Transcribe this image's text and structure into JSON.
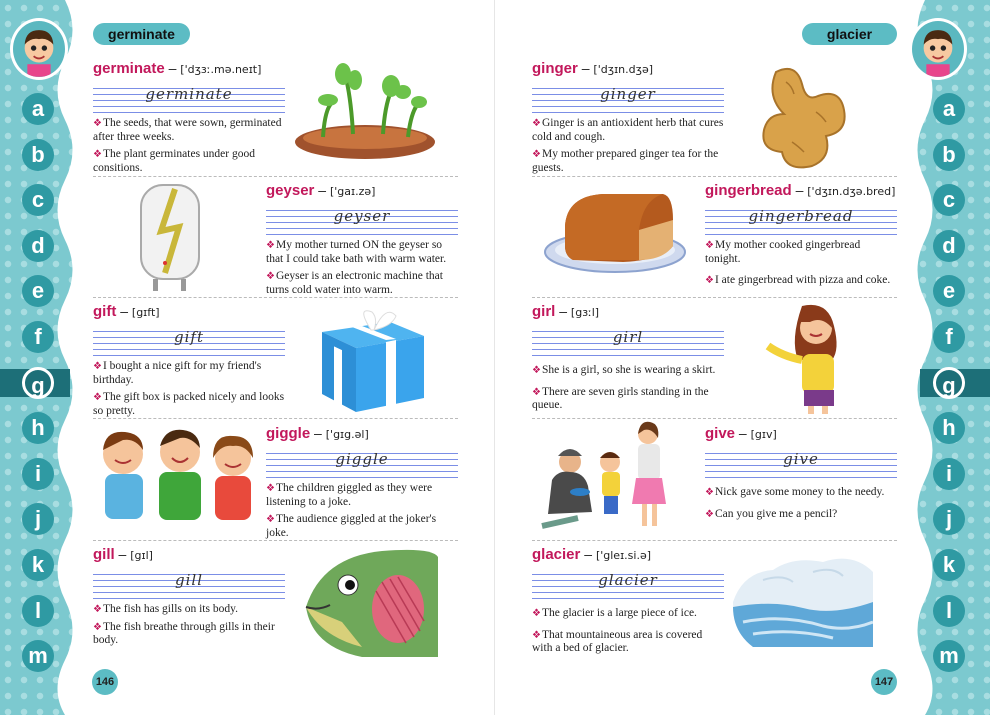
{
  "left_page": {
    "tab": "germinate",
    "page_number": "146",
    "entries": [
      {
        "word": "germinate",
        "pron": "['dʒɜː.mə.neɪt]",
        "cursive": "germinate",
        "sentences": [
          "The seeds, that were sown, germinated after three weeks.",
          "The plant germinates under good consitions."
        ]
      },
      {
        "word": "geyser",
        "pron": "['gaɪ.zə]",
        "cursive": "geyser",
        "sentences": [
          "My mother turned ON the geyser so that I could take bath with warm water.",
          "Geyser is an electronic machine that turns cold water into warm."
        ]
      },
      {
        "word": "gift",
        "pron": "[gɪft]",
        "cursive": "gift",
        "sentences": [
          "I bought a nice gift for my friend's birthday.",
          "The gift box is packed nicely and looks so pretty."
        ]
      },
      {
        "word": "giggle",
        "pron": "['gɪg.əl]",
        "cursive": "giggle",
        "sentences": [
          "The children giggled as they were listening to a joke.",
          "The audience giggled at the joker's joke."
        ]
      },
      {
        "word": "gill",
        "pron": "[gɪl]",
        "cursive": "gill",
        "sentences": [
          "The fish has gills on its body.",
          "The fish breathe through gills in their body."
        ]
      }
    ]
  },
  "right_page": {
    "tab": "glacier",
    "page_number": "147",
    "entries": [
      {
        "word": "ginger",
        "pron": "['dʒɪn.dʒə]",
        "cursive": "ginger",
        "sentences": [
          "Ginger is an antioxident herb that cures cold and cough.",
          "My mother prepared ginger tea for the guests."
        ]
      },
      {
        "word": "gingerbread",
        "pron": "['dʒɪn.dʒə.bred]",
        "cursive": "gingerbread",
        "sentences": [
          "My mother cooked gingerbread tonight.",
          "I ate gingerbread with pizza and coke."
        ]
      },
      {
        "word": "girl",
        "pron": "[gɜːl]",
        "cursive": "girl",
        "sentences": [
          "She is a girl, so she is wearing a skirt.",
          "There are seven girls standing in the queue."
        ]
      },
      {
        "word": "give",
        "pron": "[gɪv]",
        "cursive": "give",
        "sentences": [
          "Nick gave some money to the needy.",
          "Can you give me a pencil?"
        ]
      },
      {
        "word": "glacier",
        "pron": "['gleɪ.si.ə]",
        "cursive": "glacier",
        "sentences": [
          "The glacier is a large piece of ice.",
          "That mountaineous area is covered with a bed of glacier."
        ]
      }
    ]
  },
  "alphabet": [
    "a",
    "b",
    "c",
    "d",
    "e",
    "f",
    "g",
    "h",
    "i",
    "j",
    "k",
    "l",
    "m"
  ],
  "active_letter": "g",
  "colors": {
    "accent": "#5cbcc4",
    "headword": "#c2185b",
    "strip": "#7cc9cf",
    "letter_circle": "#2f9aa3"
  },
  "icons": [
    "boy-avatar-icon",
    "sprouts-illustration",
    "geyser-illustration",
    "gift-box-illustration",
    "giggling-children-illustration",
    "fish-gill-illustration",
    "ginger-root-illustration",
    "gingerbread-loaf-illustration",
    "girl-illustration",
    "giving-illustration",
    "glacier-illustration"
  ]
}
